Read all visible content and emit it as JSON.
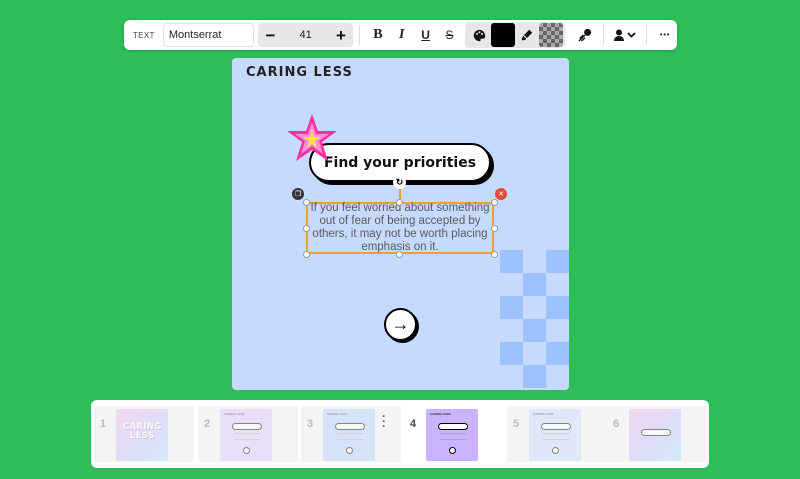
{
  "toolbar": {
    "mode_label": "TEXT",
    "font_family": "Montserrat",
    "font_size": "41",
    "decrease_label": "−",
    "increase_label": "+",
    "bold_label": "B",
    "italic_label": "I",
    "underline_label": "U",
    "strike_label": "S",
    "more_label": "•••",
    "text_color": "#000000"
  },
  "canvas": {
    "title": "CARING LESS",
    "heading": "Find your priorities",
    "body_text": "If you feel worried about something out of fear of being accepted by others, it may not be worth placing emphasis on it.",
    "background_color": "#c6daff",
    "arrow_glyph": "→"
  },
  "filmstrip": {
    "slides": [
      {
        "number": "1",
        "thumb_title": "CARING LESS",
        "active": false
      },
      {
        "number": "2",
        "thumb_title": "CARING LESS",
        "active": false
      },
      {
        "number": "3",
        "thumb_title": "CARING LESS",
        "active": false
      },
      {
        "number": "4",
        "thumb_title": "CARING LESS",
        "active": true
      },
      {
        "number": "5",
        "thumb_title": "CARING LESS",
        "active": false
      },
      {
        "number": "6",
        "thumb_title": "",
        "active": false
      }
    ]
  },
  "colors": {
    "app_background": "#2dbe58",
    "selection_border": "#f0a030",
    "delete_red": "#e04a3a",
    "star_pink": "#ff2fa8"
  }
}
